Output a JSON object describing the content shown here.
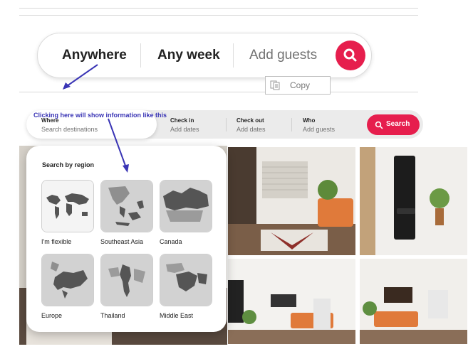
{
  "top_search": {
    "anywhere": "Anywhere",
    "any_week": "Any week",
    "add_guests": "Add guests"
  },
  "tooltip": {
    "copy_label": "Copy"
  },
  "annotation": {
    "text": "Clicking here will show information like this"
  },
  "search_bar": {
    "where_label": "Where",
    "where_placeholder": "Search destinations",
    "checkin_label": "Check in",
    "checkin_value": "Add dates",
    "checkout_label": "Check out",
    "checkout_value": "Add dates",
    "who_label": "Who",
    "who_value": "Add guests",
    "search_label": "Search"
  },
  "panel": {
    "title": "Search by region",
    "regions": [
      {
        "label": "I'm flexible",
        "selected": true
      },
      {
        "label": "Southeast Asia"
      },
      {
        "label": "Canada"
      },
      {
        "label": "Europe"
      },
      {
        "label": "Thailand"
      },
      {
        "label": "Middle East"
      }
    ]
  },
  "colors": {
    "brand": "#e61e4d",
    "annotation": "#3a35b5"
  }
}
